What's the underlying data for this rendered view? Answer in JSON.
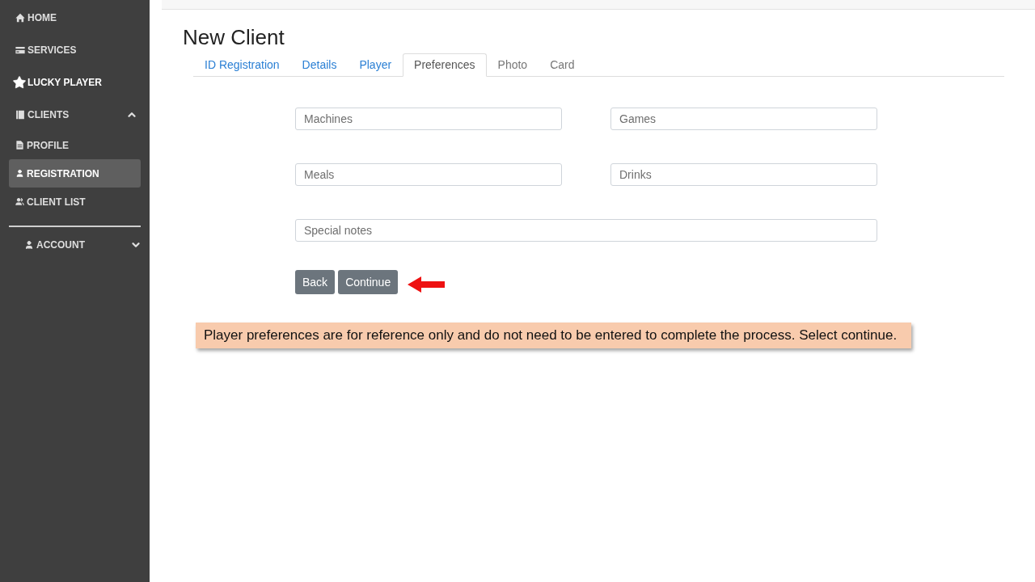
{
  "sidebar": {
    "items": [
      {
        "label": "HOME",
        "selected": false
      },
      {
        "label": "SERVICES",
        "selected": false
      },
      {
        "label": "LUCKY PLAYER",
        "selected": false
      },
      {
        "label": "CLIENTS",
        "selected": false,
        "expanded": true,
        "children": [
          {
            "label": "PROFILE",
            "selected": false
          },
          {
            "label": "REGISTRATION",
            "selected": true
          },
          {
            "label": "CLIENT LIST",
            "selected": false
          }
        ]
      }
    ],
    "account": {
      "label": "ACCOUNT",
      "expanded": false
    }
  },
  "page": {
    "title": "New Client"
  },
  "tabs": [
    {
      "label": "ID Registration",
      "selected": false,
      "disabled": false
    },
    {
      "label": "Details",
      "selected": false,
      "disabled": false
    },
    {
      "label": "Player",
      "selected": false,
      "disabled": false
    },
    {
      "label": "Preferences",
      "selected": true,
      "disabled": false
    },
    {
      "label": "Photo",
      "selected": false,
      "disabled": true
    },
    {
      "label": "Card",
      "selected": false,
      "disabled": true
    }
  ],
  "form": {
    "fields": [
      {
        "placeholder": "Machines",
        "kind": "half"
      },
      {
        "placeholder": "Games",
        "kind": "half"
      },
      {
        "placeholder": "Meals",
        "kind": "half"
      },
      {
        "placeholder": "Drinks",
        "kind": "half"
      },
      {
        "placeholder": "Special notes",
        "kind": "full"
      }
    ],
    "buttons": [
      "Back",
      "Continue"
    ]
  },
  "note": "Player preferences are for reference only and do not need to be entered to complete the process. Select continue."
}
